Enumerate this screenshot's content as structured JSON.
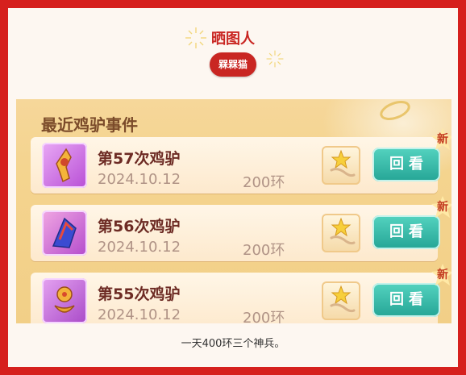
{
  "header": {
    "title": "晒图人",
    "badge": "槑槑猫"
  },
  "screenshot": {
    "section_title": "最近鸡驴事件",
    "rows": [
      {
        "title": "第57次鸡驴",
        "date": "2024.10.12",
        "rings": "200环",
        "button": "回看",
        "new_tag": "新"
      },
      {
        "title": "第56次鸡驴",
        "date": "2024.10.12",
        "rings": "200环",
        "button": "回看",
        "new_tag": "新"
      },
      {
        "title": "第55次鸡驴",
        "date": "2024.10.12",
        "rings": "200环",
        "button": "回看",
        "new_tag": "新"
      }
    ]
  },
  "caption": "一天400环三个神兵。",
  "colors": {
    "frame": "#d6201d",
    "accent": "#c92622",
    "button": "#25a596"
  }
}
